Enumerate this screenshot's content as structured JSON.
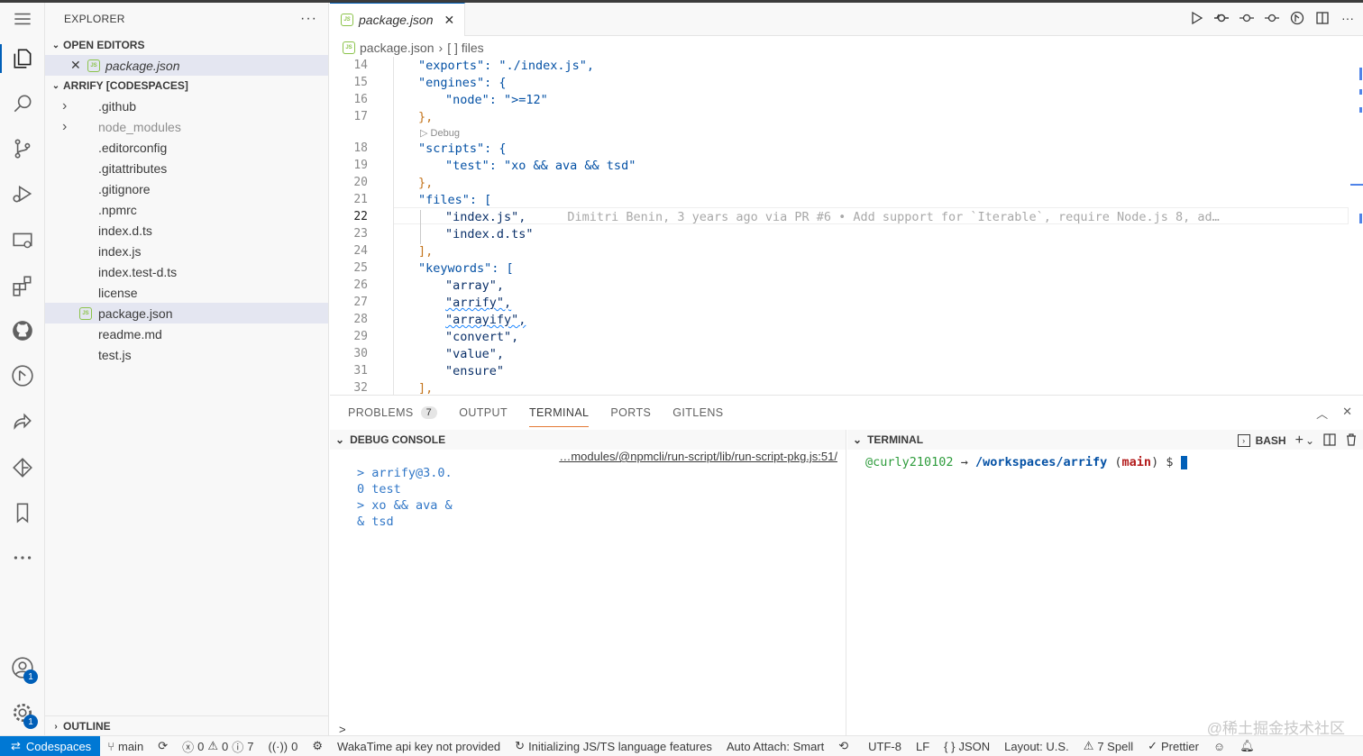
{
  "sidebar": {
    "title": "EXPLORER",
    "open_editors": {
      "header": "OPEN EDITORS",
      "items": [
        {
          "label": "package.json"
        }
      ]
    },
    "workspace": {
      "header": "ARRIFY [CODESPACES]",
      "items": [
        {
          "label": ".github",
          "folder": true
        },
        {
          "label": "node_modules",
          "folder": true
        },
        {
          "label": ".editorconfig"
        },
        {
          "label": ".gitattributes"
        },
        {
          "label": ".gitignore"
        },
        {
          "label": ".npmrc"
        },
        {
          "label": "index.d.ts"
        },
        {
          "label": "index.js"
        },
        {
          "label": "index.test-d.ts"
        },
        {
          "label": "license"
        },
        {
          "label": "package.json",
          "selected": true
        },
        {
          "label": "readme.md"
        },
        {
          "label": "test.js"
        }
      ]
    },
    "outline_header": "OUTLINE"
  },
  "activity": {
    "accounts_badge": "1",
    "manage_badge": "1"
  },
  "editor": {
    "tab_label": "package.json",
    "breadcrumb": {
      "file": "package.json",
      "symbol": "[ ] files"
    },
    "codelens": "Debug",
    "lines": [
      {
        "n": "14",
        "text": "\"exports\": \"./index.js\","
      },
      {
        "n": "15",
        "text": "\"engines\": {"
      },
      {
        "n": "16",
        "text": "\"node\": \">=12\""
      },
      {
        "n": "17",
        "text": "},"
      },
      {
        "n": "18",
        "text": "\"scripts\": {"
      },
      {
        "n": "19",
        "text": "\"test\": \"xo && ava && tsd\""
      },
      {
        "n": "20",
        "text": "},"
      },
      {
        "n": "21",
        "text": "\"files\": ["
      },
      {
        "n": "22",
        "text": "\"index.js\","
      },
      {
        "n": "23",
        "text": "\"index.d.ts\""
      },
      {
        "n": "24",
        "text": "],"
      },
      {
        "n": "25",
        "text": "\"keywords\": ["
      },
      {
        "n": "26",
        "text": "\"array\","
      },
      {
        "n": "27",
        "text": "\"arrify\","
      },
      {
        "n": "28",
        "text": "\"arrayify\","
      },
      {
        "n": "29",
        "text": "\"convert\","
      },
      {
        "n": "30",
        "text": "\"value\","
      },
      {
        "n": "31",
        "text": "\"ensure\""
      },
      {
        "n": "32",
        "text": "],"
      }
    ],
    "blame": "Dimitri Benin, 3 years ago via PR #6 • Add support for `Iterable`, require Node.js 8, ad…"
  },
  "panel": {
    "tabs": [
      {
        "label": "PROBLEMS",
        "count": "7"
      },
      {
        "label": "OUTPUT"
      },
      {
        "label": "TERMINAL",
        "active": true
      },
      {
        "label": "PORTS"
      },
      {
        "label": "GITLENS"
      }
    ],
    "debug": {
      "header": "DEBUG CONSOLE",
      "path": "…modules/@npmcli/run-script/lib/run-script-pkg.js:51/",
      "lines": [
        "> arrify@3.0.",
        "0 test",
        "> xo && ava &",
        "& tsd"
      ],
      "input_prompt": ">"
    },
    "terminal": {
      "header": "TERMINAL",
      "shell": "BASH",
      "user": "@curly210102",
      "arrow": "→",
      "cwd": "/workspaces/arrify",
      "branch": "main",
      "dollar": "$"
    }
  },
  "status": {
    "remote": "Codespaces",
    "branch": "main",
    "errors": "0",
    "warnings": "0",
    "infos": "7",
    "ports": "0",
    "wakatime": "WakaTime api key not provided",
    "ts": "Initializing JS/TS language features",
    "auto_attach": "Auto Attach: Smart",
    "encoding": "UTF-8",
    "eol": "LF",
    "language": "JSON",
    "layout": "Layout: U.S.",
    "spell": "7 Spell",
    "prettier": "Prettier"
  },
  "watermark": "@稀土掘金技术社区",
  "colors": {
    "accent": "#005fb8",
    "remote": "#0078d4",
    "terminal_tab": "#e37933"
  }
}
